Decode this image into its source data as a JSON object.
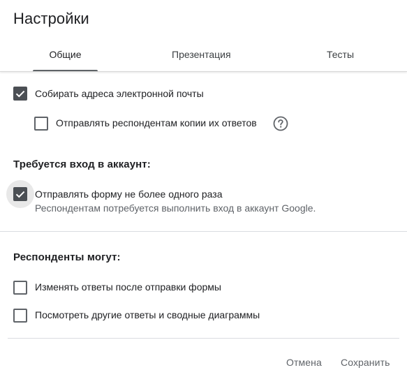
{
  "dialog": {
    "title": "Настройки"
  },
  "tabs": [
    {
      "label": "Общие",
      "active": true
    },
    {
      "label": "Презентация",
      "active": false
    },
    {
      "label": "Тесты",
      "active": false
    }
  ],
  "general": {
    "collect_emails": {
      "label": "Собирать адреса электронной почты",
      "checked": true
    },
    "send_copies": {
      "label": "Отправлять респондентам копии их ответов",
      "checked": false,
      "help_icon": "help-circle-icon"
    },
    "requires_signin": {
      "heading": "Требуется вход в аккаунт:",
      "limit_one": {
        "label": "Отправлять форму не более одного раза",
        "sublabel": "Респондентам потребуется выполнить вход в аккаунт Google.",
        "checked": true
      }
    },
    "respondents_can": {
      "heading": "Респонденты могут:",
      "edit_after_submit": {
        "label": "Изменять ответы после отправки формы",
        "checked": false
      },
      "see_summary": {
        "label": "Посмотреть другие ответы и сводные диаграммы",
        "checked": false
      }
    }
  },
  "footer": {
    "cancel_label": "Отмена",
    "save_label": "Сохранить"
  },
  "colors": {
    "checked_fill": "#4b4f54",
    "text_primary": "#202124",
    "text_secondary": "#5f6368",
    "divider": "#dadce0"
  }
}
